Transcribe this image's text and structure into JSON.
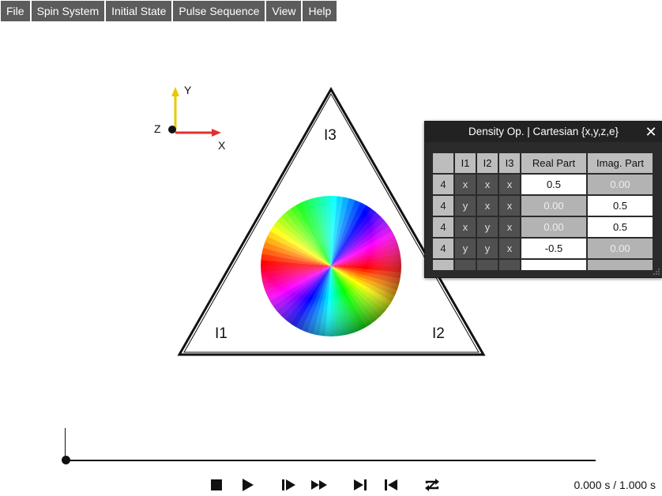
{
  "menu": [
    "File",
    "Spin System",
    "Initial State",
    "Pulse Sequence",
    "View",
    "Help"
  ],
  "axes": {
    "x_label": "X",
    "y_label": "Y",
    "z_label": "Z"
  },
  "triangle": {
    "top_label": "I3",
    "left_label": "I1",
    "right_label": "I2"
  },
  "density_panel": {
    "title": "Density Op. | Cartesian {x,y,z,e}",
    "close_glyph": "✕",
    "columns": [
      "",
      "I1",
      "I2",
      "I3",
      "Real Part",
      "Imag. Part"
    ],
    "rows": [
      {
        "count": "4",
        "i1": "x",
        "i2": "x",
        "i3": "x",
        "real": "0.5",
        "imag": "0.00",
        "active": "real"
      },
      {
        "count": "4",
        "i1": "y",
        "i2": "x",
        "i3": "x",
        "real": "0.00",
        "imag": "0.5",
        "active": "imag"
      },
      {
        "count": "4",
        "i1": "x",
        "i2": "y",
        "i3": "x",
        "real": "0.00",
        "imag": "0.5",
        "active": "imag"
      },
      {
        "count": "4",
        "i1": "y",
        "i2": "y",
        "i3": "x",
        "real": "-0.5",
        "imag": "0.00",
        "active": "real"
      }
    ]
  },
  "playback": {
    "time_readout": "0.000 s / 1.000 s",
    "progress": 0.0,
    "buttons": [
      "stop-icon",
      "play-icon",
      "step-forward-icon",
      "fast-forward-icon",
      "skip-to-end-icon",
      "skip-to-start-icon",
      "loop-icon"
    ]
  },
  "colors": {
    "menu_bg": "#5c5c5c",
    "panel_bg": "#2b2b2b",
    "x_axis": "#e03030",
    "y_axis": "#e8c800"
  }
}
